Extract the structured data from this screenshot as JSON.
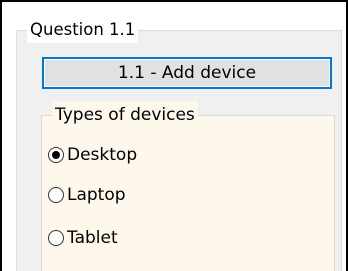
{
  "group": {
    "title": "Question 1.1"
  },
  "add_button": {
    "label": "1.1 - Add device"
  },
  "device_types": {
    "title": "Types of devices",
    "options": [
      {
        "label": "Desktop",
        "selected": true
      },
      {
        "label": "Laptop",
        "selected": false
      },
      {
        "label": "Tablet",
        "selected": false
      }
    ]
  },
  "colors": {
    "button_focus_border": "#0078d7",
    "button_face": "#e1e1e1",
    "panel_background": "#f0f0f0",
    "inner_group_background": "#fdf7ec"
  }
}
